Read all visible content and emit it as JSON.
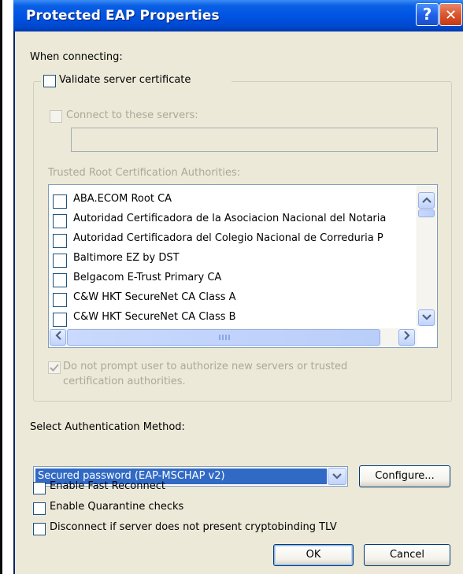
{
  "window": {
    "title": "Protected EAP Properties"
  },
  "titlebar": {
    "help_glyph": "?",
    "close_glyph": "✕"
  },
  "connecting": {
    "heading": "When connecting:",
    "validate_label": "Validate server certificate",
    "validate_checked": false,
    "connect_servers_label": "Connect to these servers:",
    "servers_value": "",
    "trusted_heading": "Trusted Root Certification Authorities:",
    "authorities": [
      {
        "label": "ABA.ECOM Root CA",
        "checked": false
      },
      {
        "label": "Autoridad Certificadora de la Asociacion Nacional del Notaria",
        "checked": false
      },
      {
        "label": "Autoridad Certificadora del Colegio Nacional de Correduria P",
        "checked": false
      },
      {
        "label": "Baltimore EZ by DST",
        "checked": false
      },
      {
        "label": "Belgacom E-Trust Primary CA",
        "checked": false
      },
      {
        "label": "C&W HKT SecureNet CA Class A",
        "checked": false
      },
      {
        "label": "C&W HKT SecureNet CA Class B",
        "checked": false
      }
    ],
    "no_prompt_line1": "Do not prompt user to authorize new servers or trusted",
    "no_prompt_line2": "certification authorities.",
    "no_prompt_checked": true
  },
  "auth": {
    "heading": "Select Authentication Method:",
    "selected_method": "Secured password (EAP-MSCHAP v2)",
    "configure_label": "Configure..."
  },
  "options": [
    {
      "label": "Enable Fast Reconnect",
      "checked": false
    },
    {
      "label": "Enable Quarantine checks",
      "checked": false
    },
    {
      "label": "Disconnect if server does not present cryptobinding TLV",
      "checked": false
    }
  ],
  "buttons": {
    "ok_label": "OK",
    "cancel_label": "Cancel"
  },
  "colors": {
    "titlebar": "#0054e3",
    "dialog_bg": "#ece9d8",
    "selection": "#316ac5",
    "close_button": "#d9522b",
    "disabled_text": "#aca899"
  },
  "icons": {
    "help": "help-icon",
    "close": "close-icon",
    "check": "checkmark-icon",
    "dropdown": "chevron-down-icon",
    "scroll_up": "scroll-up-icon",
    "scroll_down": "scroll-down-icon",
    "scroll_left": "scroll-left-icon",
    "scroll_right": "scroll-right-icon"
  }
}
